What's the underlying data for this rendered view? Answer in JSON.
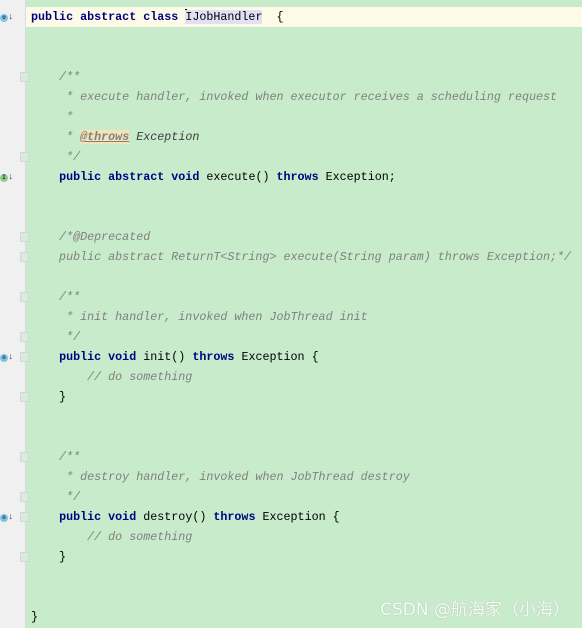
{
  "colors": {
    "background": "#c7ebcb",
    "keyword": "#000080",
    "comment": "#808080",
    "current_line": "#fdfbe8"
  },
  "lines": [
    {
      "n": 1,
      "segs": [
        [
          "kw",
          "public abstract class "
        ],
        [
          "caret",
          ""
        ],
        [
          "sel",
          "IJobHandler"
        ],
        [
          "",
          "  {"
        ]
      ],
      "current": true,
      "icon": "implemented-icon"
    },
    {
      "n": 2,
      "segs": []
    },
    {
      "n": 3,
      "segs": []
    },
    {
      "n": 4,
      "segs": [
        [
          "cm",
          "    /**"
        ]
      ],
      "fold": true
    },
    {
      "n": 5,
      "segs": [
        [
          "cm",
          "     * execute handler, invoked when executor receives a scheduling request"
        ]
      ]
    },
    {
      "n": 6,
      "segs": [
        [
          "cm",
          "     *"
        ]
      ]
    },
    {
      "n": 7,
      "segs": [
        [
          "cm",
          "     * "
        ],
        [
          "tag",
          "@throws"
        ],
        [
          "tagtext",
          " Exception"
        ]
      ]
    },
    {
      "n": 8,
      "segs": [
        [
          "cm",
          "     */"
        ]
      ],
      "fold": true
    },
    {
      "n": 9,
      "segs": [
        [
          "",
          "    "
        ],
        [
          "kw",
          "public abstract void "
        ],
        [
          "",
          "execute() "
        ],
        [
          "kw",
          "throws "
        ],
        [
          "",
          "Exception;"
        ]
      ],
      "icon": "interface-method-icon"
    },
    {
      "n": 10,
      "segs": []
    },
    {
      "n": 11,
      "segs": []
    },
    {
      "n": 12,
      "segs": [
        [
          "cm",
          "    /*@Deprecated"
        ]
      ],
      "fold": true
    },
    {
      "n": 13,
      "segs": [
        [
          "cm",
          "    public abstract ReturnT<String> execute(String param) throws Exception;*/"
        ]
      ],
      "fold": true
    },
    {
      "n": 14,
      "segs": []
    },
    {
      "n": 15,
      "segs": [
        [
          "cm",
          "    /**"
        ]
      ],
      "fold": true
    },
    {
      "n": 16,
      "segs": [
        [
          "cm",
          "     * init handler, invoked when JobThread init"
        ]
      ]
    },
    {
      "n": 17,
      "segs": [
        [
          "cm",
          "     */"
        ]
      ],
      "fold": true
    },
    {
      "n": 18,
      "segs": [
        [
          "",
          "    "
        ],
        [
          "kw",
          "public void "
        ],
        [
          "",
          "init() "
        ],
        [
          "kw",
          "throws "
        ],
        [
          "",
          "Exception {"
        ]
      ],
      "icon": "overridden-method-icon",
      "fold": true
    },
    {
      "n": 19,
      "segs": [
        [
          "cm",
          "        // do something"
        ]
      ]
    },
    {
      "n": 20,
      "segs": [
        [
          "",
          "    }"
        ]
      ],
      "fold": true
    },
    {
      "n": 21,
      "segs": []
    },
    {
      "n": 22,
      "segs": []
    },
    {
      "n": 23,
      "segs": [
        [
          "cm",
          "    /**"
        ]
      ],
      "fold": true
    },
    {
      "n": 24,
      "segs": [
        [
          "cm",
          "     * destroy handler, invoked when JobThread destroy"
        ]
      ]
    },
    {
      "n": 25,
      "segs": [
        [
          "cm",
          "     */"
        ]
      ],
      "fold": true
    },
    {
      "n": 26,
      "segs": [
        [
          "",
          "    "
        ],
        [
          "kw",
          "public void "
        ],
        [
          "",
          "destroy() "
        ],
        [
          "kw",
          "throws "
        ],
        [
          "",
          "Exception {"
        ]
      ],
      "icon": "overridden-method-icon",
      "fold": true
    },
    {
      "n": 27,
      "segs": [
        [
          "cm",
          "        // do something"
        ]
      ]
    },
    {
      "n": 28,
      "segs": [
        [
          "",
          "    }"
        ]
      ],
      "fold": true
    },
    {
      "n": 29,
      "segs": []
    },
    {
      "n": 30,
      "segs": []
    },
    {
      "n": 31,
      "segs": [
        [
          "",
          "}"
        ]
      ]
    }
  ],
  "watermark": "CSDN @航海家（小海）"
}
